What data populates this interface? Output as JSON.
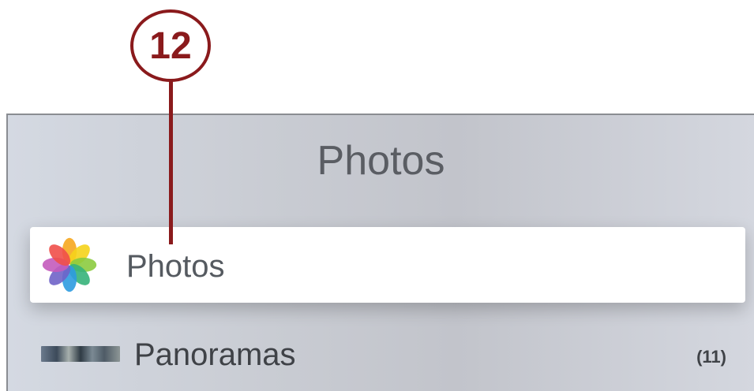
{
  "callout": {
    "number": "12",
    "color": "#8a1a1c"
  },
  "screen": {
    "title": "Photos",
    "items": [
      {
        "label": "Photos",
        "icon": "photos-app-icon",
        "selected": true
      },
      {
        "label": "Panoramas",
        "icon": "panorama-thumbnail",
        "count": "(11)",
        "selected": false
      }
    ]
  }
}
